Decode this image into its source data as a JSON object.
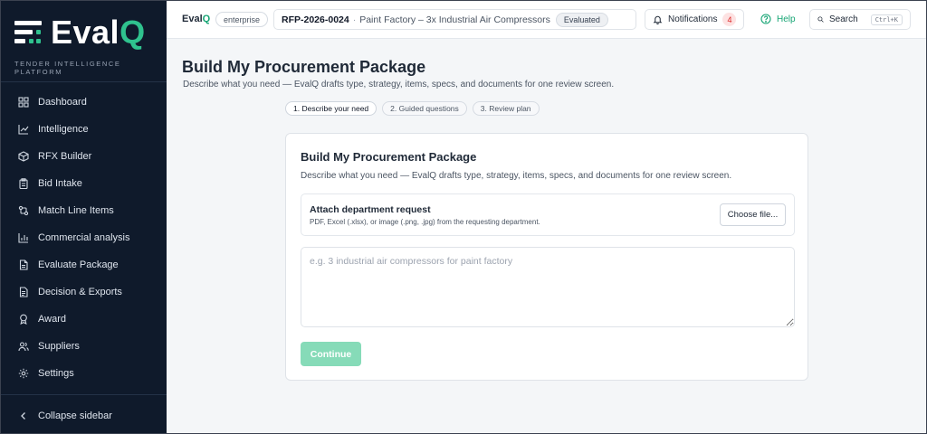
{
  "sidebar": {
    "logo_main": "Eval",
    "logo_accent": "Q",
    "tagline": "TENDER INTELLIGENCE PLATFORM",
    "items": [
      {
        "label": "Dashboard",
        "icon": "grid-icon"
      },
      {
        "label": "Intelligence",
        "icon": "chart-line-icon"
      },
      {
        "label": "RFX Builder",
        "icon": "box-icon"
      },
      {
        "label": "Bid Intake",
        "icon": "clipboard-icon"
      },
      {
        "label": "Match Line Items",
        "icon": "link-icon"
      },
      {
        "label": "Commercial analysis",
        "icon": "bar-chart-icon"
      },
      {
        "label": "Evaluate Package",
        "icon": "document-icon"
      },
      {
        "label": "Decision & Exports",
        "icon": "file-export-icon"
      },
      {
        "label": "Award",
        "icon": "award-icon"
      },
      {
        "label": "Suppliers",
        "icon": "users-icon"
      },
      {
        "label": "Settings",
        "icon": "gear-icon"
      }
    ],
    "collapse_label": "Collapse sidebar"
  },
  "topbar": {
    "brand_main": "Eval",
    "brand_accent": "Q",
    "plan": "enterprise",
    "rfp_id": "RFP-2026-0024",
    "rfp_separator": "·",
    "rfp_title": "Paint Factory – 3x Industrial Air Compressors",
    "rfp_status": "Evaluated",
    "notifications_label": "Notifications",
    "notifications_count": "4",
    "help_label": "Help",
    "search_label": "Search",
    "search_shortcut": "Ctrl+K"
  },
  "page": {
    "title": "Build My Procurement Package",
    "subtitle": "Describe what you need — EvalQ drafts type, strategy, items, specs, and documents for one review screen.",
    "steps": [
      "1. Describe your need",
      "2. Guided questions",
      "3. Review plan"
    ]
  },
  "card": {
    "title": "Build My Procurement Package",
    "subtitle": "Describe what you need — EvalQ drafts type, strategy, items, specs, and documents for one review screen.",
    "attach_title": "Attach department request",
    "attach_hint": "PDF, Excel (.xlsx), or image (.png, .jpg) from the requesting department.",
    "choose_file_label": "Choose file...",
    "need_placeholder": "e.g. 3 industrial air compressors for paint factory",
    "need_value": "",
    "continue_label": "Continue"
  },
  "colors": {
    "sidebar_bg": "#0f1a2b",
    "accent": "#16a574",
    "continue_disabled": "#86dbb8",
    "badge_bg": "#fde2e2",
    "badge_text": "#dc2626"
  }
}
